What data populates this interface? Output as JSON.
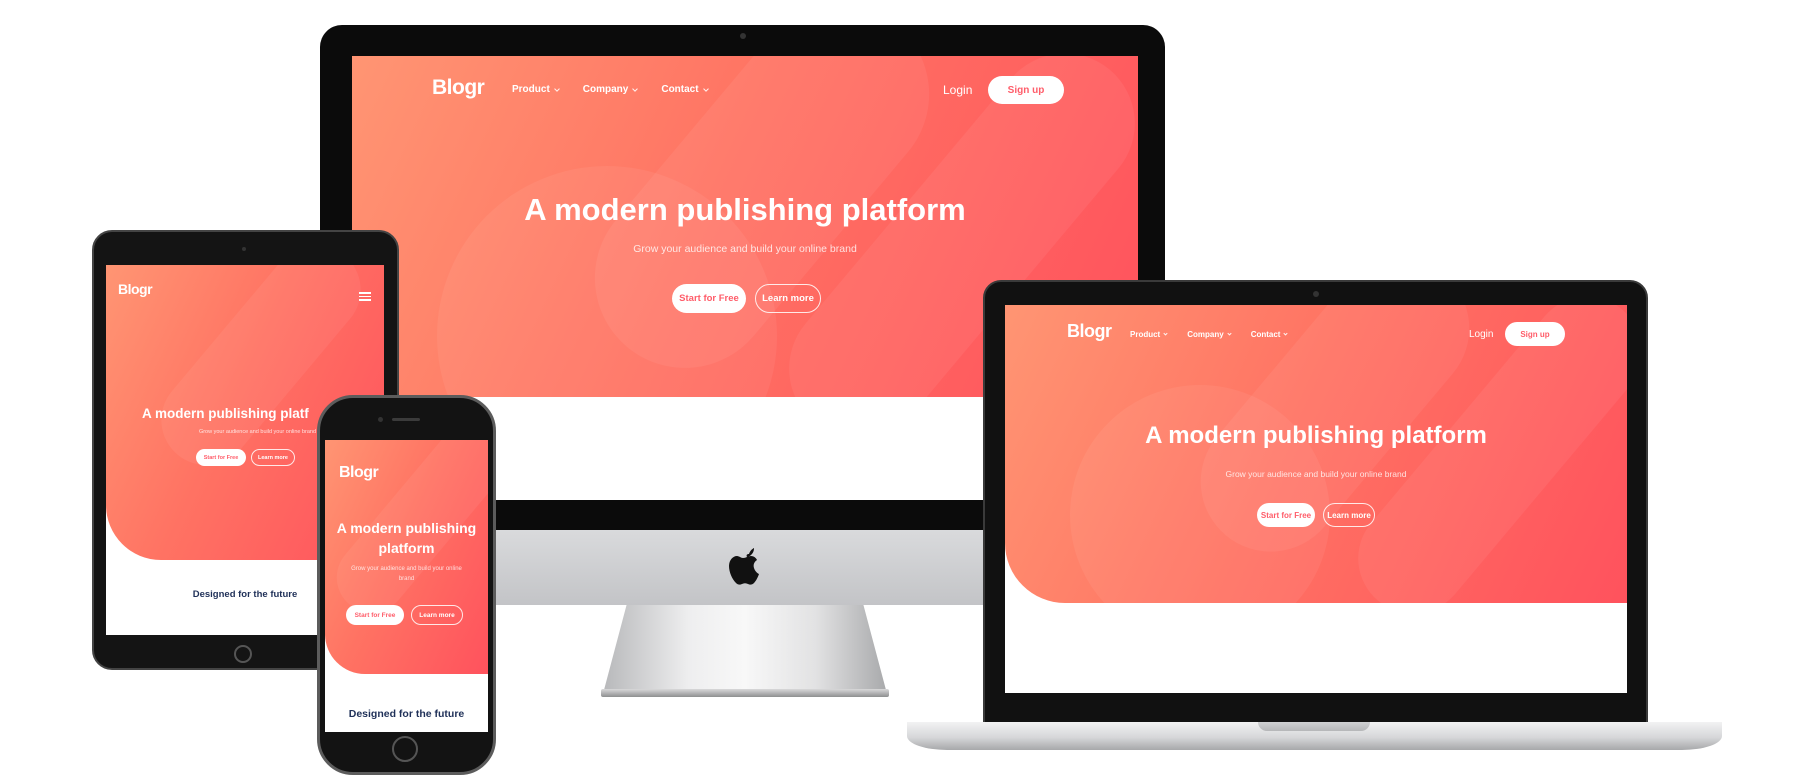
{
  "brand": {
    "logo": "Blogr",
    "colors": {
      "gradient_start": "#ff9573",
      "gradient_end": "#ff525d",
      "accent_text": "#ff5d6a",
      "heading_dark": "#1f3058"
    }
  },
  "nav": {
    "items": [
      {
        "label": "Product",
        "icon": "chevron-down-icon"
      },
      {
        "label": "Company",
        "icon": "chevron-down-icon"
      },
      {
        "label": "Contact",
        "icon": "chevron-down-icon"
      }
    ],
    "login": "Login",
    "signup": "Sign up",
    "menu_icon": "hamburger-menu-icon"
  },
  "hero": {
    "headline": "A modern publishing platform",
    "headline_line1": "A modern publishing",
    "headline_line2": "platform",
    "headline_tablet": "A modern publishing platf",
    "subtitle": "Grow your audience and build your online brand",
    "subtitle_line1": "Grow your audience and build your online",
    "subtitle_line2": "brand",
    "cta_primary": "Start for Free",
    "cta_secondary": "Learn more"
  },
  "section": {
    "title": "Designed for the future"
  },
  "devices": [
    "imac",
    "laptop",
    "tablet",
    "phone"
  ],
  "icons": {
    "imac_logo": "apple-logo-icon"
  }
}
